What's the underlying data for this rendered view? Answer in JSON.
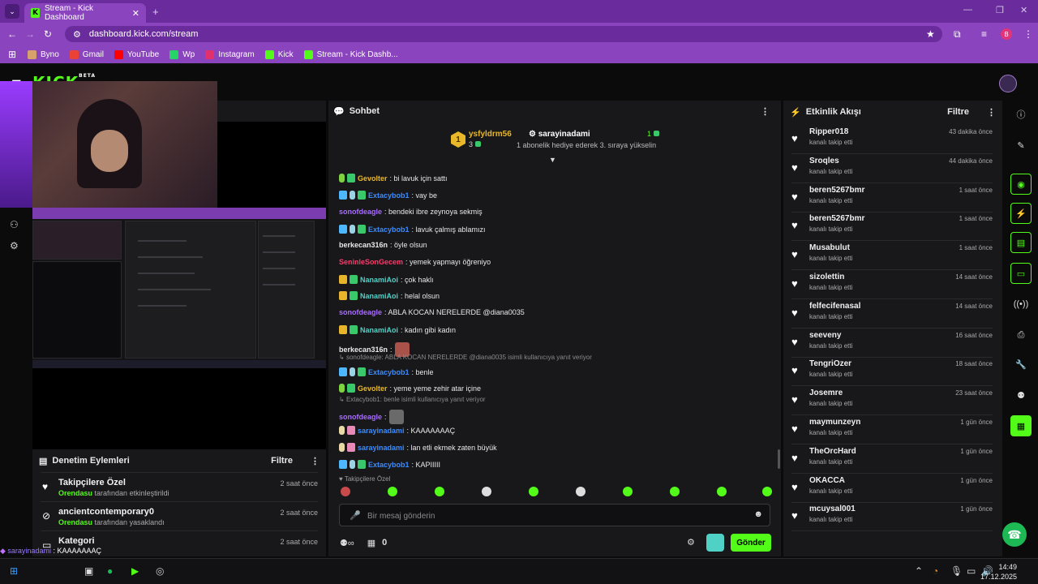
{
  "browser": {
    "tab_title": "Stream - Kick Dashboard",
    "url": "dashboard.kick.com/stream",
    "profile_initial": "B",
    "bookmarks": [
      {
        "label": "Byno",
        "color": "#d6a16a"
      },
      {
        "label": "Gmail",
        "color": "#ea4335"
      },
      {
        "label": "YouTube",
        "color": "#ff0000"
      },
      {
        "label": "Wp",
        "color": "#25d366"
      },
      {
        "label": "Instagram",
        "color": "#e1306c"
      },
      {
        "label": "Kick",
        "color": "#53fc18"
      },
      {
        "label": "Stream - Kick Dashb...",
        "color": "#53fc18"
      }
    ]
  },
  "kick": {
    "logo": "KICK",
    "beta": "BETA"
  },
  "chat": {
    "title": "Sohbet",
    "pinned": {
      "rank": "1",
      "user1": "ysfyldrm56",
      "count1": "3",
      "user2": "sarayinadami",
      "count2": "1",
      "message": "1 abonelik hediye ederek 3. sıraya yükselin"
    },
    "messages": [
      {
        "badges": [
          "bot",
          "sub"
        ],
        "user": "Gevolter",
        "color": "#e8b82a",
        "text": ": bi lavuk için sattı"
      },
      {
        "badges": [
          "vip",
          "bot2",
          "sub"
        ],
        "user": "Extacybob1",
        "color": "#3a8cff",
        "text": ": vay be"
      },
      {
        "badges": [],
        "user": "sonofdeagle",
        "color": "#a86cff",
        "text": ": bendeki ibre zeynoya sekmiş"
      },
      {
        "badges": [
          "vip",
          "bot2",
          "sub"
        ],
        "user": "Extacybob1",
        "color": "#3a8cff",
        "text": ": lavuk çalmış ablamızı"
      },
      {
        "badges": [],
        "user": "berkecan316n",
        "color": "#e8e8e8",
        "text": ": öyle olsun"
      },
      {
        "badges": [],
        "user": "SeninleSonGecem",
        "color": "#ff3a6a",
        "text": ": yemek yapmayı öğreniyo"
      },
      {
        "badges": [
          "crown",
          "sub"
        ],
        "user": "NanamiAoi",
        "color": "#4fd1c5",
        "text": ": çok haklı"
      },
      {
        "badges": [
          "crown",
          "sub"
        ],
        "user": "NanamiAoi",
        "color": "#4fd1c5",
        "text": ": helal olsun"
      },
      {
        "badges": [],
        "user": "sonofdeagle",
        "color": "#a86cff",
        "text": ": ABLA KOCAN NERELERDE @diana0035"
      },
      {
        "badges": [
          "crown",
          "sub"
        ],
        "user": "NanamiAoi",
        "color": "#4fd1c5",
        "text": ": kadın gibi kadın"
      },
      {
        "badges": [],
        "user": "berkecan316n",
        "color": "#e8e8e8",
        "text": ":"
      },
      {
        "badges": [
          "vip",
          "bot2",
          "sub"
        ],
        "user": "Extacybob1",
        "color": "#3a8cff",
        "text": ": benle"
      },
      {
        "badges": [
          "bot",
          "sub"
        ],
        "user": "Gevolter",
        "color": "#e8b82a",
        "text": ": yeme yeme zehir atar içine"
      },
      {
        "badges": [],
        "user": "sonofdeagle",
        "color": "#a86cff",
        "text": ":"
      },
      {
        "badges": [
          "beige",
          "pink"
        ],
        "user": "sarayinadami",
        "color": "#3a8cff",
        "text": ": KAAAAAAAÇ"
      },
      {
        "badges": [
          "beige",
          "pink"
        ],
        "user": "sarayinadami",
        "color": "#3a8cff",
        "text": ": lan etli ekmek zaten büyük"
      },
      {
        "badges": [
          "vip",
          "bot2",
          "sub"
        ],
        "user": "Extacybob1",
        "color": "#3a8cff",
        "text": ": KAPIIIII"
      }
    ],
    "replies": [
      "sonofdeagle: ABLA KOCAN NERELERDE @diana0035 isimli kullanıcıya yanıt veriyor",
      "Extacybob1: benle isimli kullanıcıya yanıt veriyor"
    ],
    "emote_label": "Takipçilere Özel",
    "input_placeholder": "Bir mesaj gönderin",
    "points": "0",
    "send_label": "Gönder"
  },
  "moderation": {
    "title": "Denetim Eylemleri",
    "filter": "Filtre",
    "items": [
      {
        "name": "Takipçilere Özel",
        "by": "Orendasu",
        "action": "tarafından etkinleştirildi",
        "time": "2 saat önce",
        "icon": "heart-icon"
      },
      {
        "name": "ancientcontemporary0",
        "by": "Orendasu",
        "action": "tarafından yasaklandı",
        "time": "2 saat önce",
        "icon": "ban-icon"
      },
      {
        "name": "Kategori",
        "by": "",
        "action": "",
        "time": "2 saat önce",
        "icon": "category-icon"
      }
    ]
  },
  "activity": {
    "title": "Etkinlik Akışı",
    "filter": "Filtre",
    "items": [
      {
        "name": "Ripper018",
        "sub": "kanalı takip etti",
        "time": "43 dakika önce"
      },
      {
        "name": "Sroqles",
        "sub": "kanalı takip etti",
        "time": "44 dakika önce"
      },
      {
        "name": "beren5267bmr",
        "sub": "kanalı takip etti",
        "time": "1 saat önce"
      },
      {
        "name": "beren5267bmr",
        "sub": "kanalı takip etti",
        "time": "1 saat önce"
      },
      {
        "name": "Musabulut",
        "sub": "kanalı takip etti",
        "time": "1 saat önce"
      },
      {
        "name": "sizolettin",
        "sub": "kanalı takip etti",
        "time": "14 saat önce"
      },
      {
        "name": "felfecifenasal",
        "sub": "kanalı takip etti",
        "time": "14 saat önce"
      },
      {
        "name": "seeveny",
        "sub": "kanalı takip etti",
        "time": "16 saat önce"
      },
      {
        "name": "TengriOzer",
        "sub": "kanalı takip etti",
        "time": "18 saat önce"
      },
      {
        "name": "Josemre",
        "sub": "kanalı takip etti",
        "time": "23 saat önce"
      },
      {
        "name": "maymunzeyn",
        "sub": "kanalı takip etti",
        "time": "1 gün önce"
      },
      {
        "name": "TheOrcHard",
        "sub": "kanalı takip etti",
        "time": "1 gün önce"
      },
      {
        "name": "OKACCA",
        "sub": "kanalı takip etti",
        "time": "1 gün önce"
      },
      {
        "name": "mcuysal001",
        "sub": "kanalı takip etti",
        "time": "1 gün önce"
      }
    ]
  },
  "overlay": [
    {
      "user": "sarayinadami",
      "text": " : KAAAAAAAÇ"
    },
    {
      "user": "sarayinadami",
      "text": " : lan etli ekmek zaten büyük"
    },
    {
      "user": "Extacybob1",
      "text": " : KAPIIIII"
    }
  ],
  "taskbar": {
    "time": "14:49",
    "date": "17.12.2025"
  }
}
